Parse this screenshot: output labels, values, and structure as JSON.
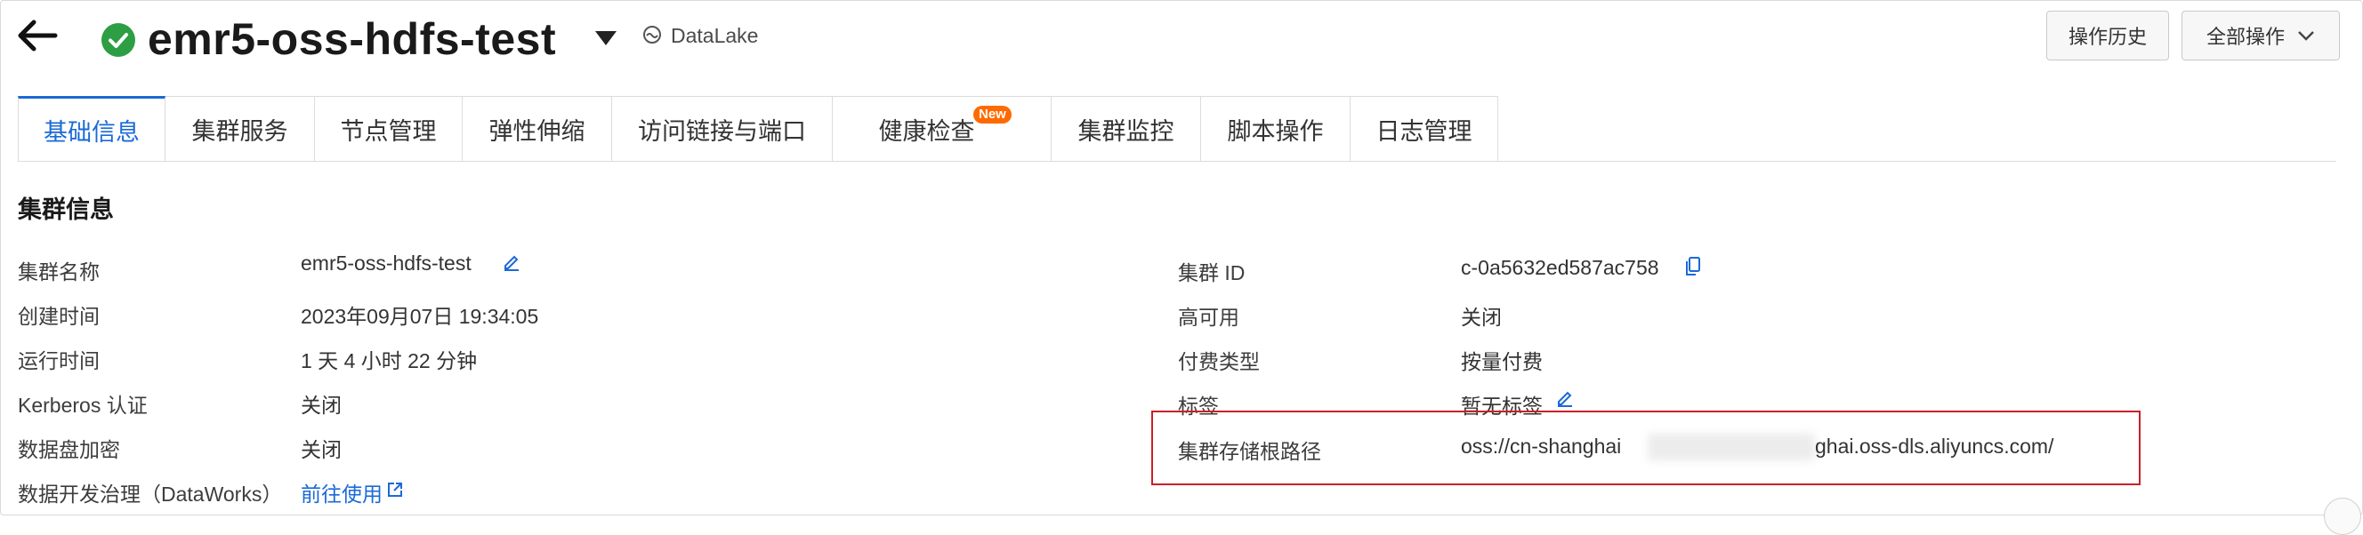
{
  "header": {
    "cluster_name": "emr5-oss-hdfs-test",
    "cluster_type": "DataLake",
    "history_button": "操作历史",
    "all_ops_button": "全部操作"
  },
  "tabs": [
    {
      "label": "基础信息",
      "active": true
    },
    {
      "label": "集群服务"
    },
    {
      "label": "节点管理"
    },
    {
      "label": "弹性伸缩"
    },
    {
      "label": "访问链接与端口"
    },
    {
      "label": "健康检查",
      "badge": "New"
    },
    {
      "label": "集群监控"
    },
    {
      "label": "脚本操作"
    },
    {
      "label": "日志管理"
    }
  ],
  "section_title": "集群信息",
  "left_fields": [
    {
      "label": "集群名称",
      "value": "emr5-oss-hdfs-test"
    },
    {
      "label": "创建时间",
      "value": "2023年09月07日 19:34:05"
    },
    {
      "label": "运行时间",
      "value": "1 天 4 小时 22 分钟"
    },
    {
      "label": "Kerberos 认证",
      "value": "关闭"
    },
    {
      "label": "数据盘加密",
      "value": "关闭"
    },
    {
      "label": "数据开发治理（DataWorks）",
      "value": "前往使用"
    }
  ],
  "right_fields": [
    {
      "label": "集群 ID",
      "value": "c-0a5632ed587ac758"
    },
    {
      "label": "高可用",
      "value": "关闭"
    },
    {
      "label": "付费类型",
      "value": "按量付费"
    },
    {
      "label": "标签",
      "value": "暂无标签"
    },
    {
      "label": "集群存储根路径",
      "value_prefix": "oss://cn-shanghai",
      "value_suffix": "ghai.oss-dls.aliyuncs.com/"
    }
  ],
  "colors": {
    "accent": "#1b6ad6",
    "success": "#2e9e44",
    "badge": "#ff6a00",
    "highlight": "#c8202a"
  }
}
